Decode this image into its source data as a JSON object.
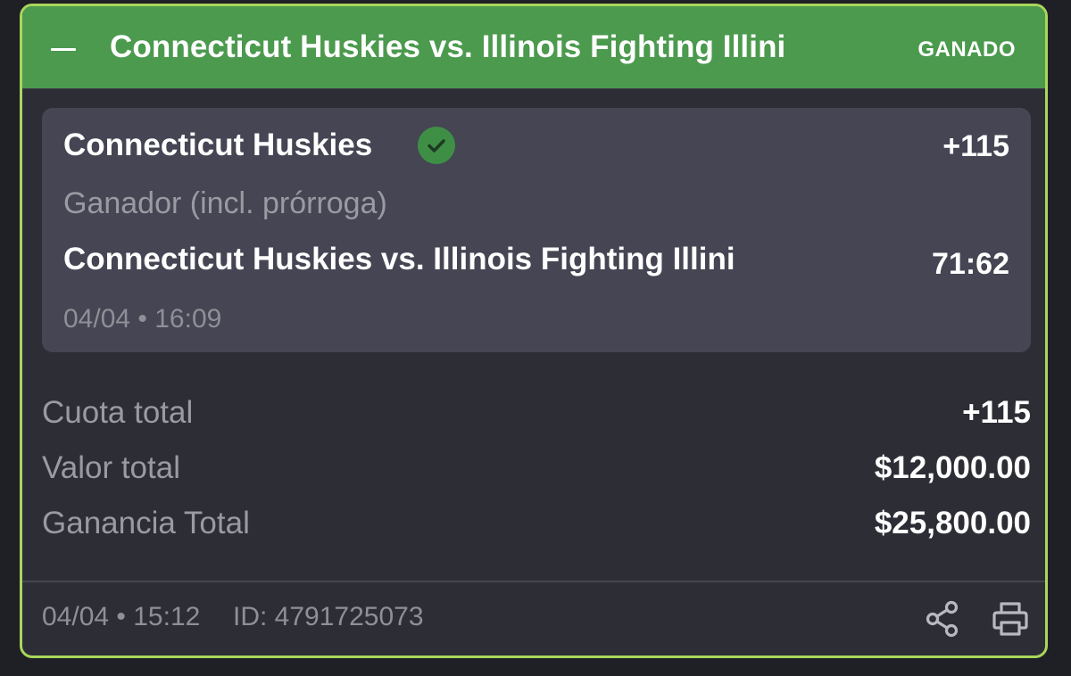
{
  "header": {
    "title": "Connecticut Huskies vs. Illinois Fighting Illini",
    "status": "GANADO",
    "collapse_icon": "minus-icon"
  },
  "selection": {
    "team": "Connecticut Huskies",
    "status_icon": "check-circle-icon",
    "odds": "+115",
    "market": "Ganador (incl. prórroga)",
    "event": "Connecticut Huskies vs. Illinois Fighting Illini",
    "score": "71:62",
    "datetime": "04/04 • 16:09"
  },
  "summary": {
    "total_odds_label": "Cuota total",
    "total_odds_value": "+115",
    "total_stake_label": "Valor total",
    "total_stake_value": "$12,000.00",
    "total_win_label": "Ganancia Total",
    "total_win_value": "$25,800.00"
  },
  "footer": {
    "datetime": "04/04 • 15:12",
    "id_text": "ID: 4791725073",
    "share_icon": "share-icon",
    "print_icon": "print-icon"
  },
  "colors": {
    "header_bg": "#4b9a4e",
    "card_border": "#a9d65b",
    "card_bg": "#2d2d36",
    "selection_bg": "#454553",
    "check_green": "#3e8f45"
  }
}
